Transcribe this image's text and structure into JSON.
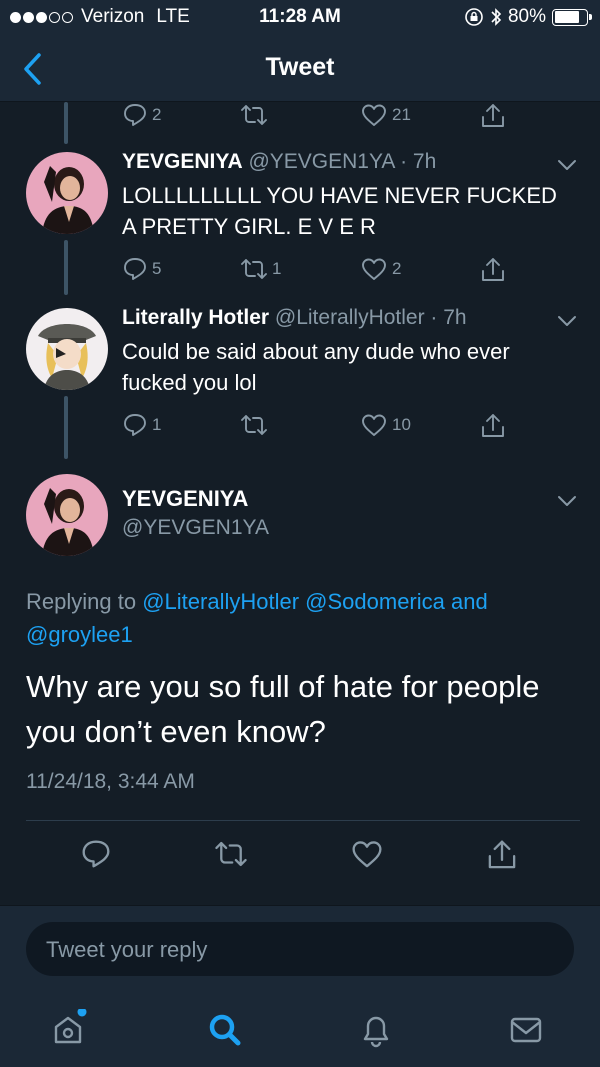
{
  "status_bar": {
    "carrier": "Verizon",
    "network": "LTE",
    "time": "11:28 AM",
    "battery_pct": "80%",
    "battery_level": 0.8
  },
  "nav": {
    "title": "Tweet"
  },
  "top_actions": {
    "replies": "2",
    "retweets": "",
    "likes": "21"
  },
  "tweets": [
    {
      "name": "YEVGENIYA",
      "handle": "@YEVGEN1YA · 7h",
      "text": "LOLLLLLLLLL YOU HAVE NEVER FUCKED A PRETTY GIRL. E V E R",
      "replies": "5",
      "retweets": "1",
      "likes": "2"
    },
    {
      "name": "Literally Hotler",
      "handle": "@LiterallyHotler · 7h",
      "text": "Could be said about any dude who ever fucked you lol",
      "replies": "1",
      "retweets": "",
      "likes": "10"
    }
  ],
  "main_tweet": {
    "name": "YEVGENIYA",
    "handle": "@YEVGEN1YA",
    "replying_prefix": "Replying to",
    "mention_1": "@LiterallyHotler",
    "mention_2": "@Sodomerica",
    "and": "and",
    "mention_3": "@groylee1",
    "text": "Why are you so full of hate for people you don’t even know?",
    "timestamp": "11/24/18, 3:44 AM"
  },
  "compose": {
    "placeholder": "Tweet your reply"
  },
  "colors": {
    "background": "#141d26",
    "bar": "#1b2836",
    "accent": "#1da1f2",
    "muted": "#8899a6"
  },
  "icons": [
    "back-chevron-icon",
    "reply-icon",
    "retweet-icon",
    "like-icon",
    "share-icon",
    "chevron-down-icon",
    "home-icon",
    "search-icon",
    "notifications-icon",
    "messages-icon"
  ]
}
